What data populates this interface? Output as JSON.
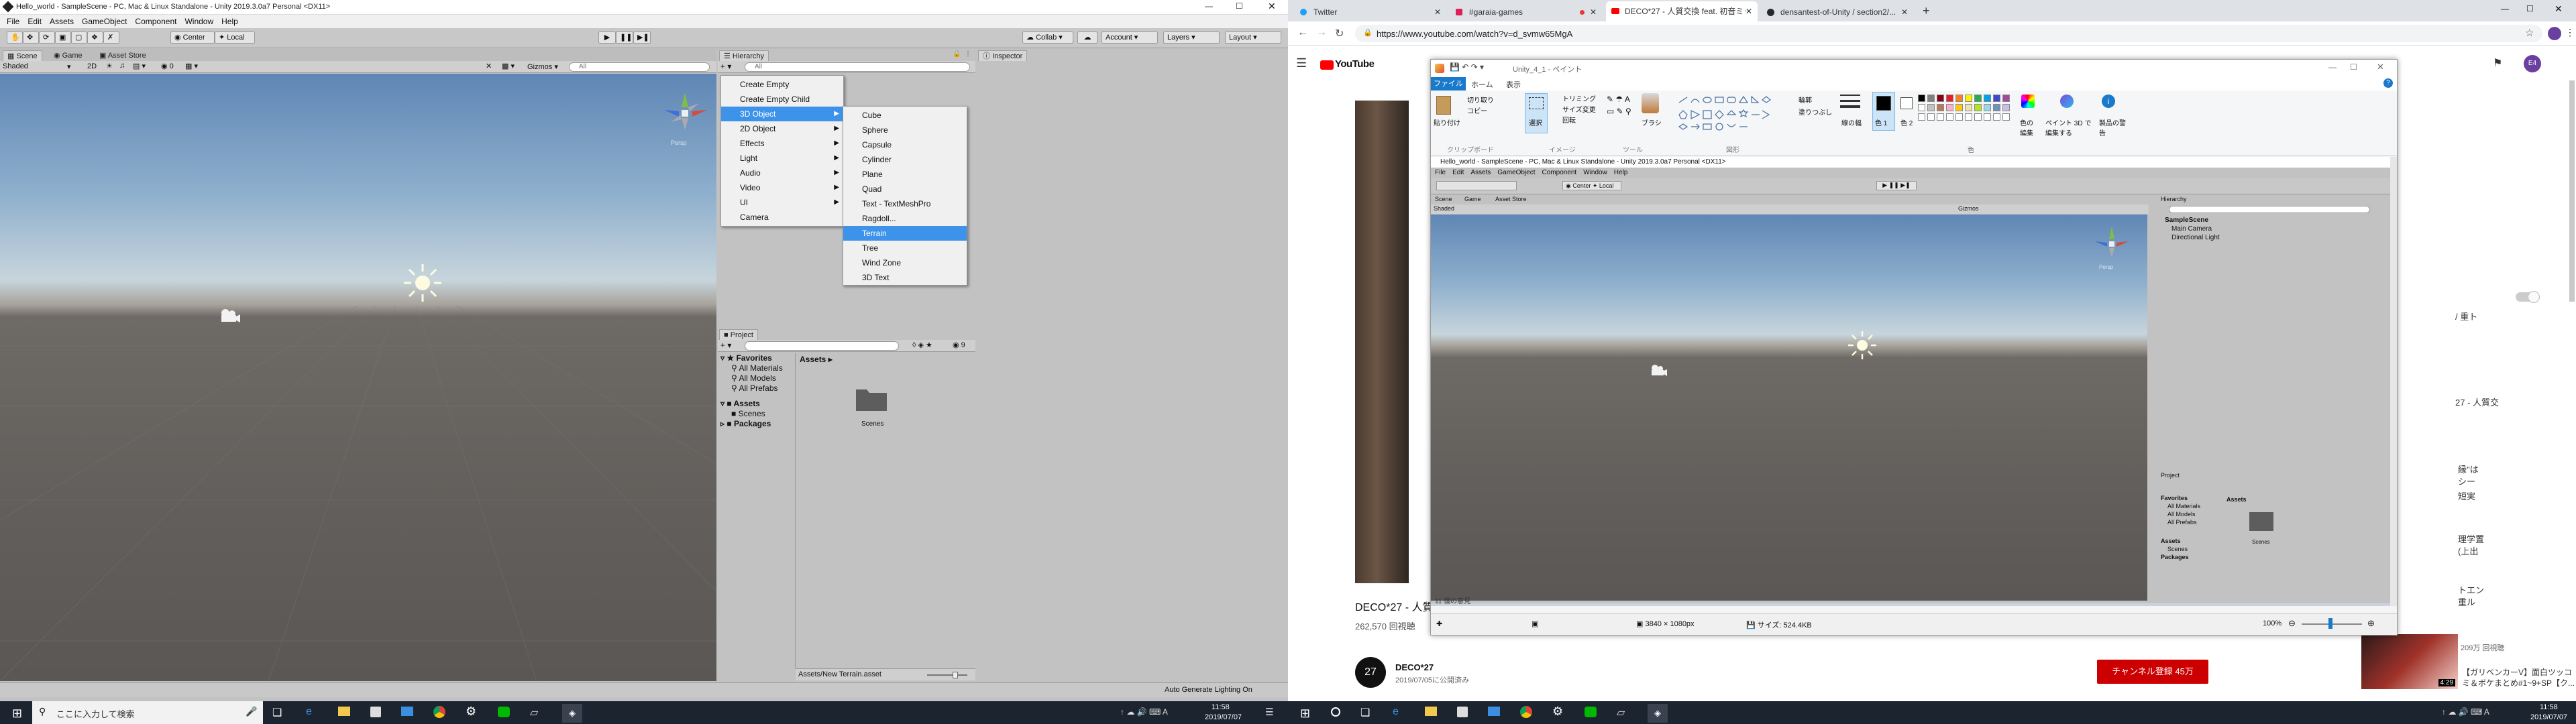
{
  "left_unity": {
    "title": "Hello_world - SampleScene - PC, Mac & Linux Standalone - Unity 2019.3.0a7 Personal <DX11>",
    "menu": [
      "File",
      "Edit",
      "Assets",
      "GameObject",
      "Component",
      "Window",
      "Help"
    ],
    "toolbar": {
      "center": "Center",
      "local": "Local",
      "collab": "Collab",
      "account": "Account",
      "layers": "Layers",
      "layout": "Layout"
    },
    "tabs": {
      "scene": "Scene",
      "game": "Game",
      "asset_store": "Asset Store"
    },
    "scene_bar": {
      "shaded": "Shaded",
      "two_d": "2D",
      "gizmos": "Gizmos",
      "search": "All"
    },
    "gizmo_label": "Persp",
    "hierarchy": {
      "title": "Hierarchy",
      "search": "All"
    },
    "inspector": {
      "title": "Inspector"
    },
    "context_menu": [
      "Create Empty",
      "Create Empty Child",
      "3D Object",
      "2D Object",
      "Effects",
      "Light",
      "Audio",
      "Video",
      "UI",
      "Camera"
    ],
    "context_menu_highlight": "3D Object",
    "submenu": [
      "Cube",
      "Sphere",
      "Capsule",
      "Cylinder",
      "Plane",
      "Quad",
      "Text - TextMeshPro",
      "Ragdoll...",
      "Terrain",
      "Tree",
      "Wind Zone",
      "3D Text"
    ],
    "submenu_highlight": "Terrain",
    "project": {
      "title": "Project",
      "favorites": "Favorites",
      "fav_items": [
        "All Materials",
        "All Models",
        "All Prefabs"
      ],
      "assets": "Assets",
      "asset_items": [
        "Scenes"
      ],
      "packages": "Packages",
      "breadcrumb": "Assets",
      "folder": "Scenes",
      "path": "Assets/New Terrain.asset"
    },
    "status": "Auto Generate Lighting On"
  },
  "taskbar_left": {
    "search_placeholder": "ここに入力して検索",
    "time": "11:58",
    "date": "2019/07/07"
  },
  "browser": {
    "tabs": [
      "Twitter",
      "#garaia-games",
      "DECO*27 - 人質交換 feat. 初音ミク",
      "densantest-of-Unity / section2/..."
    ],
    "url": "https://www.youtube.com/watch?v=d_svmw65MgA",
    "youtube_logo": "YouTube",
    "video_title": "DECO*27 - 人質",
    "views": "262,570 回視聴",
    "channel": "DECO*27",
    "published": "2019/07/05に公開済み",
    "subscribe": "チャンネル登録 45万",
    "avatar": "E4",
    "side_texts": [
      "/ 重ト",
      "27 - 人質交",
      "縁\"は",
      "シー",
      "短実",
      "理学置",
      "(上出",
      "トエン",
      "重ル",
      "209万 回視聴",
      "【ガリベンカーV】面白ツッコ",
      "ミ＆ボケまとめ#1~9+SP【ク..."
    ],
    "thumb_time": "4:29"
  },
  "paint": {
    "title": "Unity_4_1 - ペイント",
    "ribbon_tabs": [
      "ファイル",
      "ホーム",
      "表示"
    ],
    "groups": [
      "クリップボード",
      "イメージ",
      "ツール",
      "図形",
      "色"
    ],
    "buttons": [
      "貼り付け",
      "切り取り",
      "コピー",
      "選択",
      "トリミング",
      "サイズ変更",
      "回転",
      "ブラシ",
      "輪郭",
      "塗りつぶし",
      "線の幅",
      "色 1",
      "色 2",
      "色の編集",
      "ペイント 3D で編集する",
      "製品の警告"
    ],
    "status": {
      "size": "3840 × 1080px",
      "file_size": "サイズ: 524.4KB",
      "zoom": "100%"
    },
    "palette": [
      "#000000",
      "#7f7f7f",
      "#880015",
      "#ed1c24",
      "#ff7f27",
      "#fff200",
      "#22b14c",
      "#00a2e8",
      "#3f48cc",
      "#a349a4",
      "#ffffff",
      "#c3c3c3",
      "#b97a57",
      "#ffaec9",
      "#ffc90e",
      "#efe4b0",
      "#b5e61d",
      "#99d9ea",
      "#7092be",
      "#c8bfe7"
    ]
  },
  "inner_unity": {
    "title": "Hello_world - SampleScene - PC, Mac & Linux Standalone - Unity 2019.3.0a7 Personal <DX11>",
    "menu": [
      "File",
      "Edit",
      "Assets",
      "GameObject",
      "Component",
      "Window",
      "Help"
    ],
    "hierarchy_items": [
      "SampleScene",
      "Main Camera",
      "Directional Light"
    ],
    "comment": "11 個の意見"
  },
  "taskbar_right": {
    "time": "11:58",
    "date": "2019/07/07"
  }
}
